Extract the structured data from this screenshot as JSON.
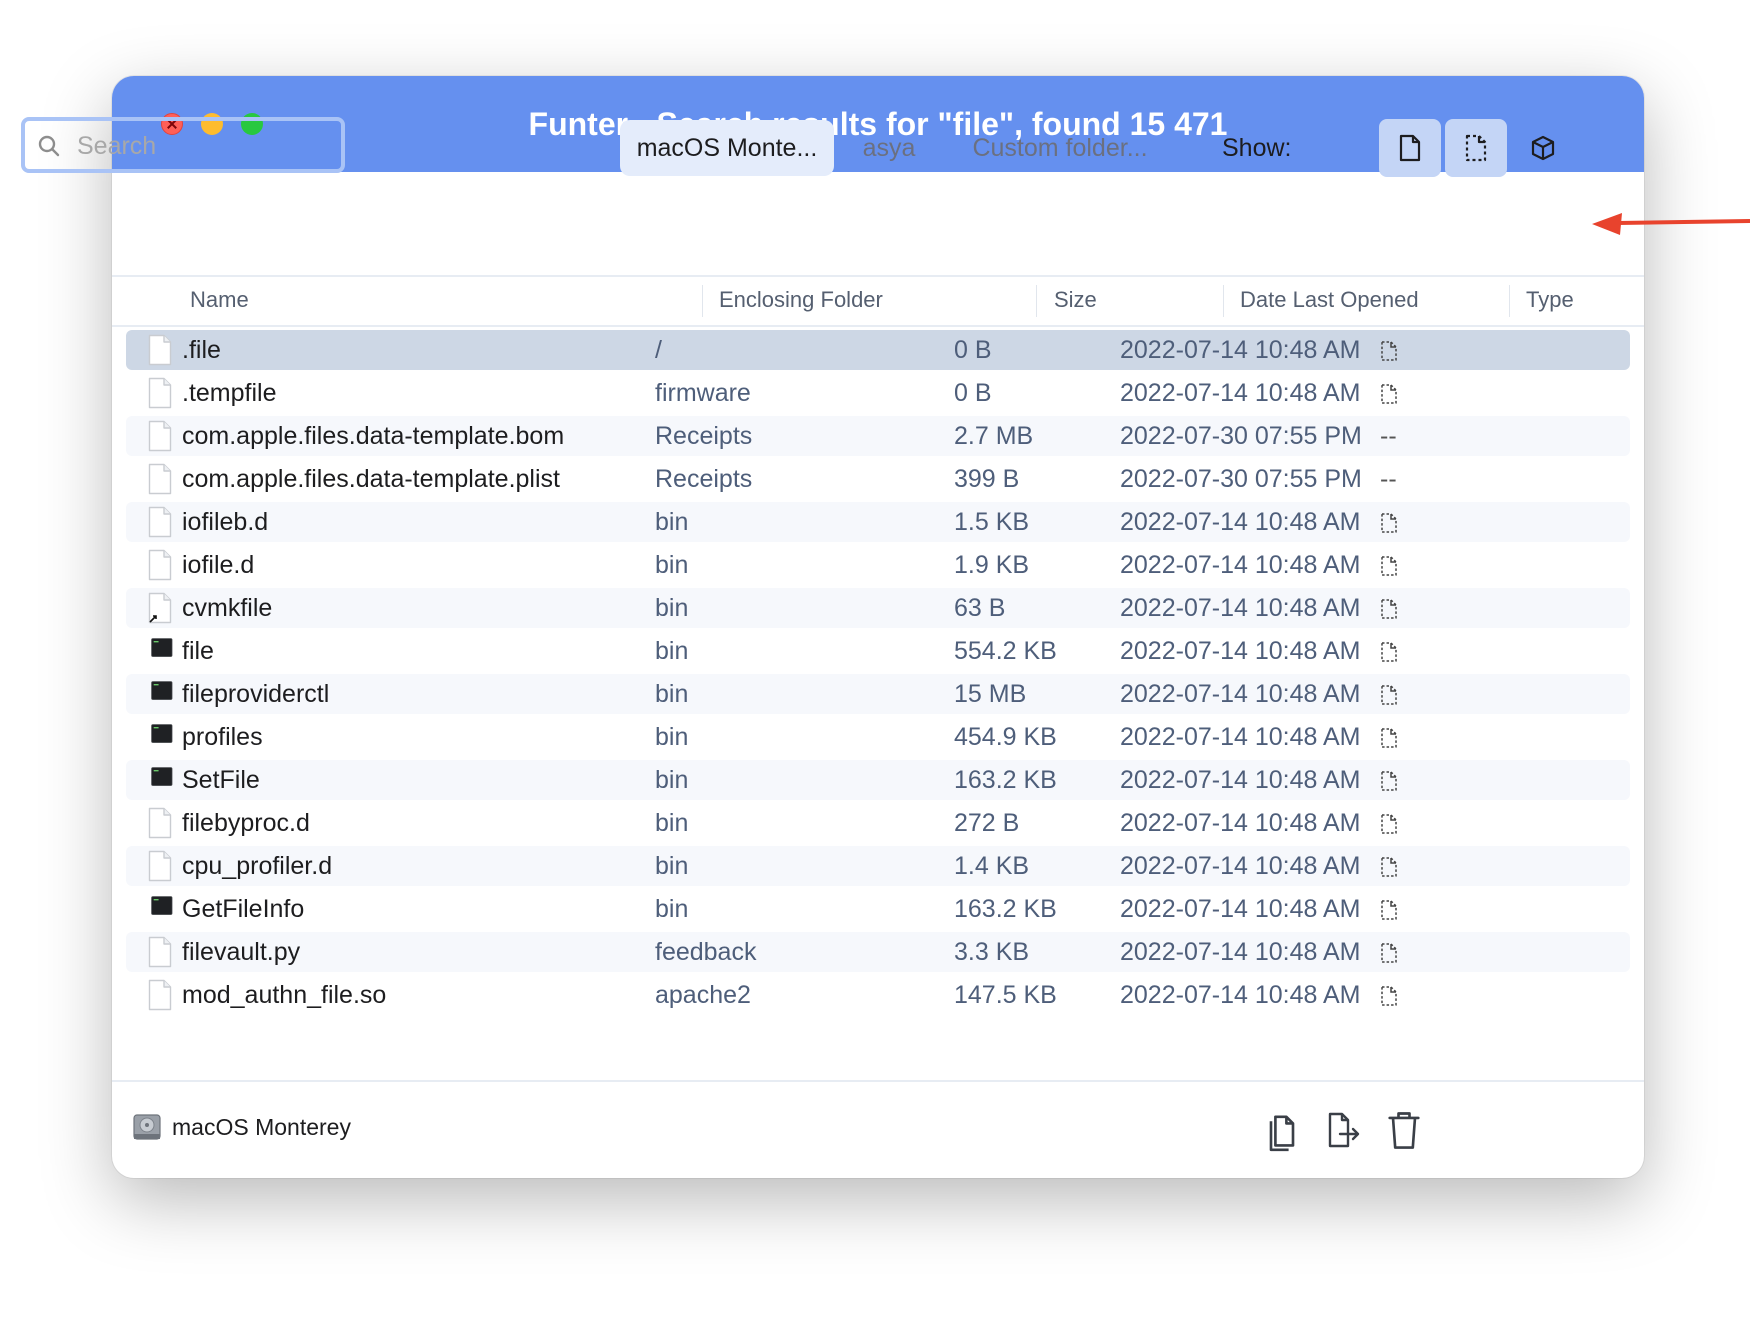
{
  "window": {
    "title": "Funter - Search results for \"file\", found 15 471"
  },
  "toolbar": {
    "search_placeholder": "Search",
    "search_value": "",
    "scopes": [
      "macOS Monte...",
      "asya",
      "Custom folder..."
    ],
    "show_label": "Show:"
  },
  "table": {
    "columns": [
      "Name",
      "Enclosing Folder",
      "Size",
      "Date Last Opened",
      "Type"
    ],
    "rows": [
      {
        "name": ".file",
        "folder": "/",
        "size": "0 B",
        "date": "2022-07-14 10:48 AM",
        "type": "doc",
        "kind": "doc"
      },
      {
        "name": ".tempfile",
        "folder": "firmware",
        "size": "0 B",
        "date": "2022-07-14 10:48 AM",
        "type": "doc",
        "kind": "doc"
      },
      {
        "name": "com.apple.files.data-template.bom",
        "folder": "Receipts",
        "size": "2.7 MB",
        "date": "2022-07-30 07:55 PM",
        "type": "--",
        "kind": "doc"
      },
      {
        "name": "com.apple.files.data-template.plist",
        "folder": "Receipts",
        "size": "399 B",
        "date": "2022-07-30 07:55 PM",
        "type": "--",
        "kind": "doc"
      },
      {
        "name": "iofileb.d",
        "folder": "bin",
        "size": "1.5 KB",
        "date": "2022-07-14 10:48 AM",
        "type": "doc",
        "kind": "doc"
      },
      {
        "name": "iofile.d",
        "folder": "bin",
        "size": "1.9 KB",
        "date": "2022-07-14 10:48 AM",
        "type": "doc",
        "kind": "doc"
      },
      {
        "name": "cvmkfile",
        "folder": "bin",
        "size": "63 B",
        "date": "2022-07-14 10:48 AM",
        "type": "doc",
        "kind": "alias"
      },
      {
        "name": "file",
        "folder": "bin",
        "size": "554.2 KB",
        "date": "2022-07-14 10:48 AM",
        "type": "doc",
        "kind": "exec"
      },
      {
        "name": "fileproviderctl",
        "folder": "bin",
        "size": "15 MB",
        "date": "2022-07-14 10:48 AM",
        "type": "doc",
        "kind": "exec"
      },
      {
        "name": "profiles",
        "folder": "bin",
        "size": "454.9 KB",
        "date": "2022-07-14 10:48 AM",
        "type": "doc",
        "kind": "exec"
      },
      {
        "name": "SetFile",
        "folder": "bin",
        "size": "163.2 KB",
        "date": "2022-07-14 10:48 AM",
        "type": "doc",
        "kind": "exec"
      },
      {
        "name": "filebyproc.d",
        "folder": "bin",
        "size": "272 B",
        "date": "2022-07-14 10:48 AM",
        "type": "doc",
        "kind": "doc"
      },
      {
        "name": "cpu_profiler.d",
        "folder": "bin",
        "size": "1.4 KB",
        "date": "2022-07-14 10:48 AM",
        "type": "doc",
        "kind": "doc"
      },
      {
        "name": "GetFileInfo",
        "folder": "bin",
        "size": "163.2 KB",
        "date": "2022-07-14 10:48 AM",
        "type": "doc",
        "kind": "exec"
      },
      {
        "name": "filevault.py",
        "folder": "feedback",
        "size": "3.3 KB",
        "date": "2022-07-14 10:48 AM",
        "type": "doc",
        "kind": "doc"
      },
      {
        "name": "mod_authn_file.so",
        "folder": "apache2",
        "size": "147.5 KB",
        "date": "2022-07-14 10:48 AM",
        "type": "doc",
        "kind": "doc"
      }
    ]
  },
  "footer": {
    "volume": "macOS Monterey"
  },
  "colors": {
    "titlebar": "#6590ef",
    "selected_row": "#cdd7e5",
    "annotation_arrow": "#e8432d"
  }
}
